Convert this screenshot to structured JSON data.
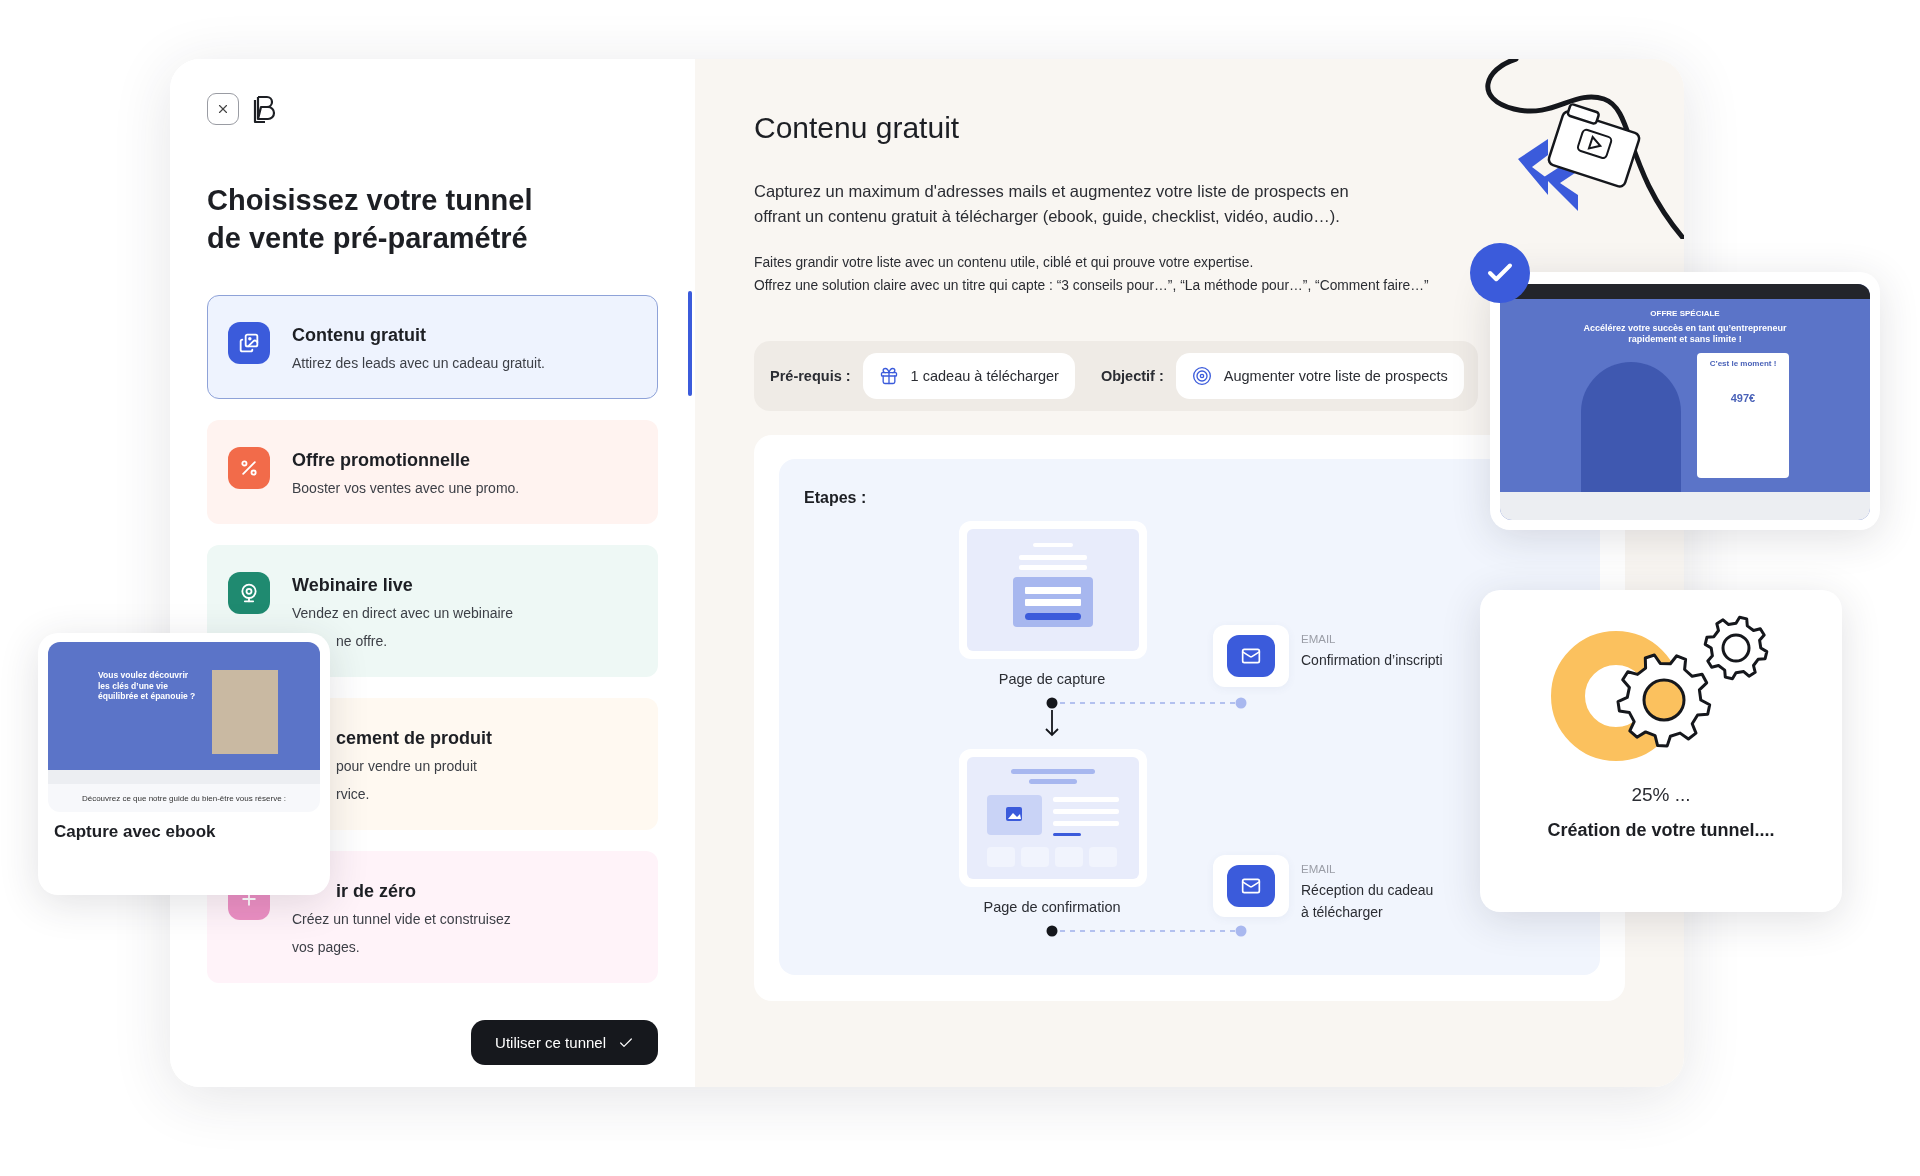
{
  "left": {
    "title_lines": [
      "Choisissez votre tunnel",
      "de vente pré-paramétré"
    ],
    "templates": [
      {
        "title": "Contenu gratuit",
        "title_covered": false,
        "description": [
          {
            "text": "Attirez des leads avec un cadeau gratuit.",
            "covered": false
          }
        ],
        "color": "#eef3fe",
        "selected": true
      },
      {
        "title": "Offre promotionnelle",
        "title_covered": false,
        "description": [
          {
            "text": "Booster vos ventes avec une promo.",
            "covered": false
          }
        ],
        "color": "#fff3f0",
        "selected": false
      },
      {
        "title": "Webinaire live",
        "title_covered": false,
        "description": [
          {
            "text": "Vendez en direct avec un webinaire",
            "covered": false
          },
          {
            "text": "ne offre.",
            "covered": true
          }
        ],
        "color": "#eef8f5",
        "selected": false
      },
      {
        "title": "cement de produit",
        "title_covered": true,
        "description": [
          {
            "text": "pour vendre un produit",
            "covered": true
          },
          {
            "text": "rvice.",
            "covered": true
          }
        ],
        "color": "#fff9f1",
        "selected": false
      },
      {
        "title": "ir de zéro",
        "title_covered": true,
        "description": [
          {
            "text": "Créez un tunnel vide et construisez",
            "covered": false
          },
          {
            "text": "vos pages.",
            "covered": false
          }
        ],
        "color": "#fff3f9",
        "selected": false
      }
    ],
    "use_button": "Utiliser ce tunnel"
  },
  "right": {
    "title": "Contenu gratuit",
    "intro": "Capturez un maximum d'adresses mails et augmentez votre liste de prospects en offrant un contenu gratuit à télécharger (ebook, guide, checklist, vidéo, audio…).",
    "tips": [
      "Faites grandir votre liste avec un contenu utile, ciblé et qui prouve votre expertise.",
      "Offrez une solution claire avec un titre qui capte : “3 conseils pour…”, “La méthode pour…”, “Comment faire…”"
    ],
    "requirements": {
      "label": "Pré-requis :",
      "value": "1 cadeau à télécharger"
    },
    "goal": {
      "label": "Objectif :",
      "value": "Augmenter votre liste de prospects"
    },
    "steps": {
      "heading": "Etapes :",
      "pages": [
        {
          "label": "Page de capture",
          "kind": "capture"
        },
        {
          "label": "Page de confirmation",
          "kind": "confirmation"
        }
      ],
      "emails": [
        {
          "tag": "EMAIL",
          "lines": [
            "Confirmation d’inscripti"
          ]
        },
        {
          "tag": "EMAIL",
          "lines": [
            "Réception du cadeau",
            "à télécharger"
          ]
        }
      ]
    }
  },
  "ebook_preview": {
    "headline": "Vous voulez découvrir les clés d’une vie équilibrée et épanouie ?",
    "footer": "Découvrez ce que notre guide du bien-être vous réserve :",
    "caption": "Capture avec ebook"
  },
  "sales_preview": {
    "eyebrow": "OFFRE SPÉCIALE",
    "headline": "Accélérez votre succès en tant qu’entrepreneur rapidement et sans limite !",
    "offer_title": "C’est le moment !",
    "price": "497€"
  },
  "loader": {
    "percent": "25% ...",
    "message": "Création de votre tunnel...."
  }
}
